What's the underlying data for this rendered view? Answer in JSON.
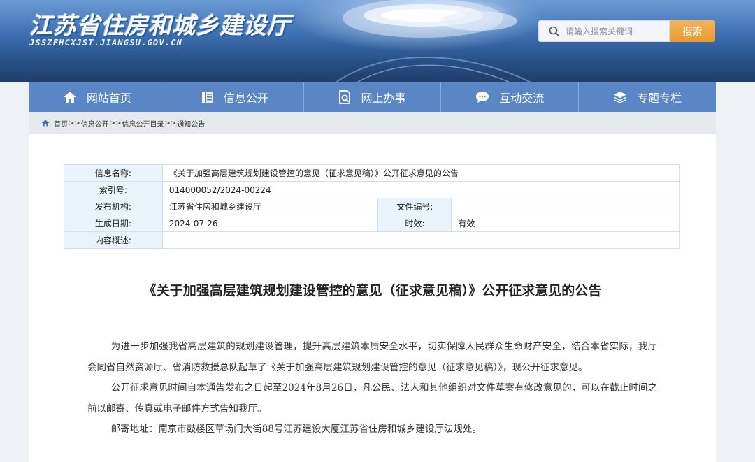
{
  "header": {
    "site_title": "江苏省住房和城乡建设厅",
    "site_url": "JSSZFHCXJST.JIANGSU.GOV.CN",
    "search_placeholder": "请输入搜索关键词",
    "search_button": "搜索"
  },
  "nav": {
    "items": [
      {
        "label": "网站首页",
        "icon": "home-icon"
      },
      {
        "label": "信息公开",
        "icon": "document-list-icon"
      },
      {
        "label": "网上办事",
        "icon": "search-document-icon"
      },
      {
        "label": "互动交流",
        "icon": "chat-bubble-icon"
      },
      {
        "label": "专题专栏",
        "icon": "layers-icon"
      }
    ]
  },
  "breadcrumb": {
    "items": [
      "首页",
      "信息公开",
      "信息公开目录",
      "通知公告"
    ],
    "separator": ">>"
  },
  "meta": {
    "name_label": "信息名称:",
    "name_value": "《关于加强高层建筑规划建设管控的意见（征求意见稿）》公开征求意见的公告",
    "index_label": "索引号:",
    "index_value": "014000052/2024-00224",
    "publisher_label": "发布机构:",
    "publisher_value": "江苏省住房和城乡建设厅",
    "doc_no_label": "文件编号:",
    "doc_no_value": "",
    "date_label": "生成日期:",
    "date_value": "2024-07-26",
    "validity_label": "时效:",
    "validity_value": "有效",
    "summary_label": "内容概述:",
    "summary_value": ""
  },
  "article": {
    "title": "《关于加强高层建筑规划建设管控的意见（征求意见稿）》公开征求意见的公告",
    "paragraphs": [
      "为进一步加强我省高层建筑的规划建设管理，提升高层建筑本质安全水平，切实保障人民群众生命财产安全，结合本省实际，我厅会同省自然资源厅、省消防救援总队起草了《关于加强高层建筑规划建设管控的意见（征求意见稿）》，现公开征求意见。",
      "公开征求意见时间自本通告发布之日起至2024年8月26日，凡公民、法人和其他组织对文件草案有修改意见的，可以在截止时间之前以邮寄、传真或电子邮件方式告知我厅。",
      "邮寄地址：南京市鼓楼区草场门大街88号江苏建设大厦江苏省住房和城乡建设厅法规处。"
    ]
  },
  "colors": {
    "nav_bg": "#5b86c5",
    "search_button": "#e69a32",
    "table_label_bg": "#eaf3fa"
  }
}
